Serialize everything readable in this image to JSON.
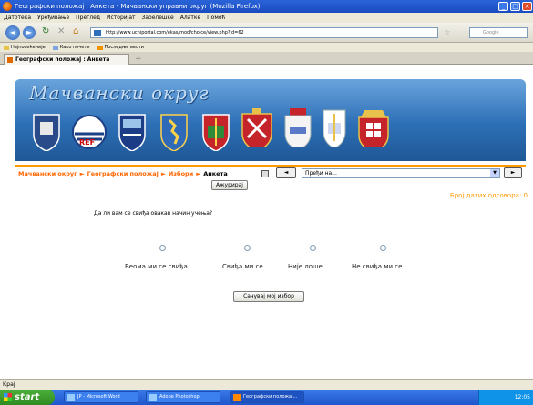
{
  "window": {
    "title": "Географски положај : Анкета - Мачвански управни округ (Mozilla Firefox)"
  },
  "menu": [
    "Датотека",
    "Уређивање",
    "Преглед",
    "Историјат",
    "Забелешке",
    "Алатке",
    "Помоћ"
  ],
  "url": "http://www.uchiportal.com/ekas/mod/choice/view.php?id=62",
  "search_placeholder": "Google",
  "bookmarks": [
    "Најпосећеније",
    "Како почети",
    "Последње вести"
  ],
  "tab": {
    "label": "Географски положај : Анкета",
    "new_tab": "+"
  },
  "banner": {
    "title": "Мачвански округ"
  },
  "breadcrumb": {
    "items": [
      "Мачвански округ",
      "Географски положај",
      "Избори"
    ],
    "current": "Анкета",
    "separator": "►"
  },
  "jump": {
    "prev": "◄",
    "next": "►",
    "select": "Пређи на...",
    "dropdown": "▼"
  },
  "update_button": "Ажурирај",
  "responses_label": "Број датих одговора: 0",
  "question": "Да ли вам се свиђа овакав начин учења?",
  "options": [
    "Веома ми се свиђа.",
    "Свиђа ми се.",
    "Није лоше.",
    "Не свиђа ми се."
  ],
  "save_button": "Сачувај мој избор",
  "status": "Крај",
  "taskbar": {
    "start": "start",
    "tasks": [
      "JP - Microsoft Word",
      "Adobe Photoshop",
      "Географски положај..."
    ],
    "clock": "12:05"
  }
}
